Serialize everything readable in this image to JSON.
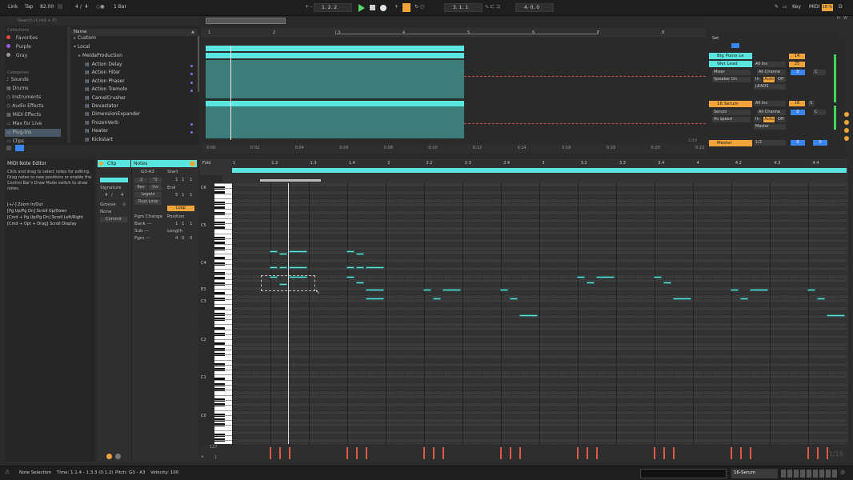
{
  "topbar": {
    "link": "Link",
    "tap": "Tap",
    "tempo": "82.00",
    "signature_num": "4",
    "signature_den": "4",
    "quantize": "1 Bar",
    "position": "1.  2.  2",
    "loop_start": "3.  1.  1",
    "loop_length": "4.  0.  0",
    "key": "Key",
    "midi": "MIDI",
    "cpu": "18 %",
    "d": "D"
  },
  "browser": {
    "search_placeholder": "Search (Cmd + F)",
    "collections_label": "Collections",
    "collections": [
      {
        "label": "Favorites",
        "color": "#e8453c"
      },
      {
        "label": "Purple",
        "color": "#9b5de5"
      },
      {
        "label": "Gray",
        "color": "#9a9a9a"
      }
    ],
    "categories_label": "Categories",
    "categories": [
      "Sounds",
      "Drums",
      "Instruments",
      "Audio Effects",
      "MIDI Effects",
      "Max for Live",
      "Plug-Ins",
      "Clips"
    ],
    "name_header": "Name",
    "tree": [
      "Custom",
      "Local",
      "MeldaProduction"
    ],
    "files": [
      "Action Delay",
      "Action Filter",
      "Action Phaser",
      "Action Tremolo",
      "CamelCrusher",
      "Devastator",
      "DimensionExpander",
      "FrozenVerb",
      "Heater",
      "Kickstart"
    ]
  },
  "arrangement": {
    "bar_numbers": [
      "1",
      "2",
      "3",
      "4",
      "5",
      "6",
      "7",
      "8"
    ],
    "time_labels": [
      "0:02",
      "0:04",
      "0:06",
      "0:08",
      "0:10",
      "0:12",
      "0:14",
      "0:16",
      "0:18",
      "0:20",
      "0:22"
    ],
    "time_zero": "0:00",
    "zoom": "1/16"
  },
  "mixer": {
    "set_label": "Set",
    "tracks": [
      {
        "name": "Big Piano Le",
        "color": "#5ae6de"
      },
      {
        "name": "Wet Lead",
        "color": "#5ae6de",
        "input": "All Ins",
        "channel": "All Channe",
        "device1": "Mixer",
        "device2": "Speaker On",
        "volume": "14",
        "pan": "0",
        "c": "C",
        "out": "LEADS",
        "s": "S"
      },
      {
        "name": "16 Serum",
        "color": "#f0a43a",
        "input": "All Ins",
        "channel": "All Channe",
        "device1": "Serum",
        "device2": "lfo speed",
        "volume": "16",
        "pan": "0",
        "c": "C",
        "out": "Master",
        "s": "S"
      },
      {
        "name": "Master",
        "color": "#f0a43a",
        "fraction": "1/2",
        "pan": "0",
        "vol": "0"
      }
    ],
    "track1_num": "25",
    "in_label": "In",
    "auto_label": "Auto",
    "off_label": "Off"
  },
  "info": {
    "title": "MIDI Note Editor",
    "body": "Click and drag to select notes for editing. Drag notes to new positions or enable the Control Bar's Draw Mode switch to draw notes.",
    "shortcuts": [
      "[+/-] Zoom In/Out",
      "[Pg Up/Pg Dn] Scroll Up/Down",
      "[Cmd + Pg Up/Pg Dn] Scroll Left/Right",
      "[Cmd + Opt + Drag] Scroll Display"
    ]
  },
  "clipview": {
    "clip_tab": "Clip",
    "notes_tab": "Notes",
    "signature_label": "Signature",
    "sig_num": "4",
    "sig_den": "4",
    "groove_label": "Groove",
    "groove_value": "None",
    "commit": "Commit",
    "range": "G3-A3",
    "half": ":2",
    "double": "*2",
    "rev": "Rev",
    "inv": "Inv",
    "legato": "Legato",
    "dupl_loop": "Dupl.Loop",
    "start_label": "Start",
    "start": [
      "1",
      "1",
      "1"
    ],
    "end_label": "End",
    "end": [
      "5",
      "1",
      "1"
    ],
    "loop_label": "Loop",
    "position_label": "Position",
    "position": [
      "1",
      "1",
      "1"
    ],
    "length_label": "Length",
    "length": [
      "4",
      "0",
      "0"
    ],
    "pgm_change": "Pgm Change",
    "bank": "Bank ---",
    "sub": "Sub ---",
    "pgm": "Pgm ---",
    "set": "Set"
  },
  "roll": {
    "fold": "Fold",
    "beat_labels": [
      "1",
      "1.2",
      "1.3",
      "1.4",
      "2",
      "2.2",
      "2.3",
      "2.4",
      "3",
      "3.2",
      "3.3",
      "3.4",
      "4",
      "4.2",
      "4.3",
      "4.4"
    ],
    "octave_labels": [
      "C6",
      "C5",
      "C4",
      "E3",
      "C3",
      "C2",
      "C1",
      "C0"
    ],
    "vel_max": "127",
    "vel_min": "1",
    "zoom": "1/16"
  },
  "status": {
    "selection": "Note Selection",
    "time": "Time: 1.1.4 - 1.3.3 (0.1.2)",
    "pitch": "Pitch: G3 - A3",
    "velocity": "Velocity: 100",
    "track": "16-Serum"
  }
}
